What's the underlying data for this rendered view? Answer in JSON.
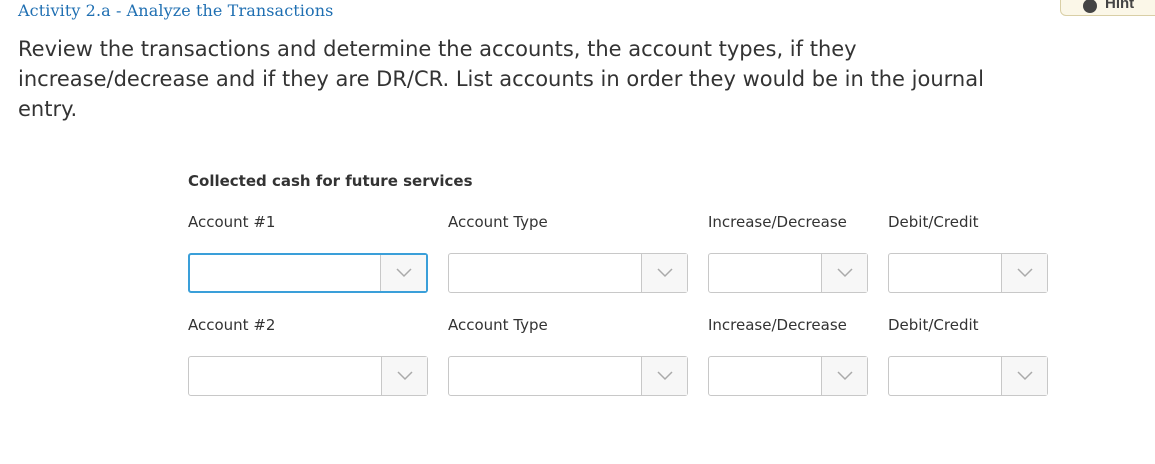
{
  "header": {
    "activity_title": "Activity 2.a - Analyze the Transactions",
    "hint_label": "Hint"
  },
  "instructions": "Review the transactions and determine the accounts, the account types, if they increase/decrease and if they are DR/CR. List accounts in order they would be in the journal entry.",
  "transaction": {
    "label": "Collected cash for future services",
    "rows": [
      {
        "labels": {
          "account": "Account #1",
          "account_type": "Account Type",
          "increase_decrease": "Increase/Decrease",
          "debit_credit": "Debit/Credit"
        },
        "values": {
          "account": "",
          "account_type": "",
          "increase_decrease": "",
          "debit_credit": ""
        }
      },
      {
        "labels": {
          "account": "Account #2",
          "account_type": "Account Type",
          "increase_decrease": "Increase/Decrease",
          "debit_credit": "Debit/Credit"
        },
        "values": {
          "account": "",
          "account_type": "",
          "increase_decrease": "",
          "debit_credit": ""
        }
      }
    ]
  },
  "colors": {
    "title_blue": "#1f6fb2",
    "focus_border": "#3a9fd9",
    "select_border": "#c8c8c8",
    "text": "#333333"
  },
  "icons": [
    "info-icon",
    "chevron-down-icon"
  ]
}
